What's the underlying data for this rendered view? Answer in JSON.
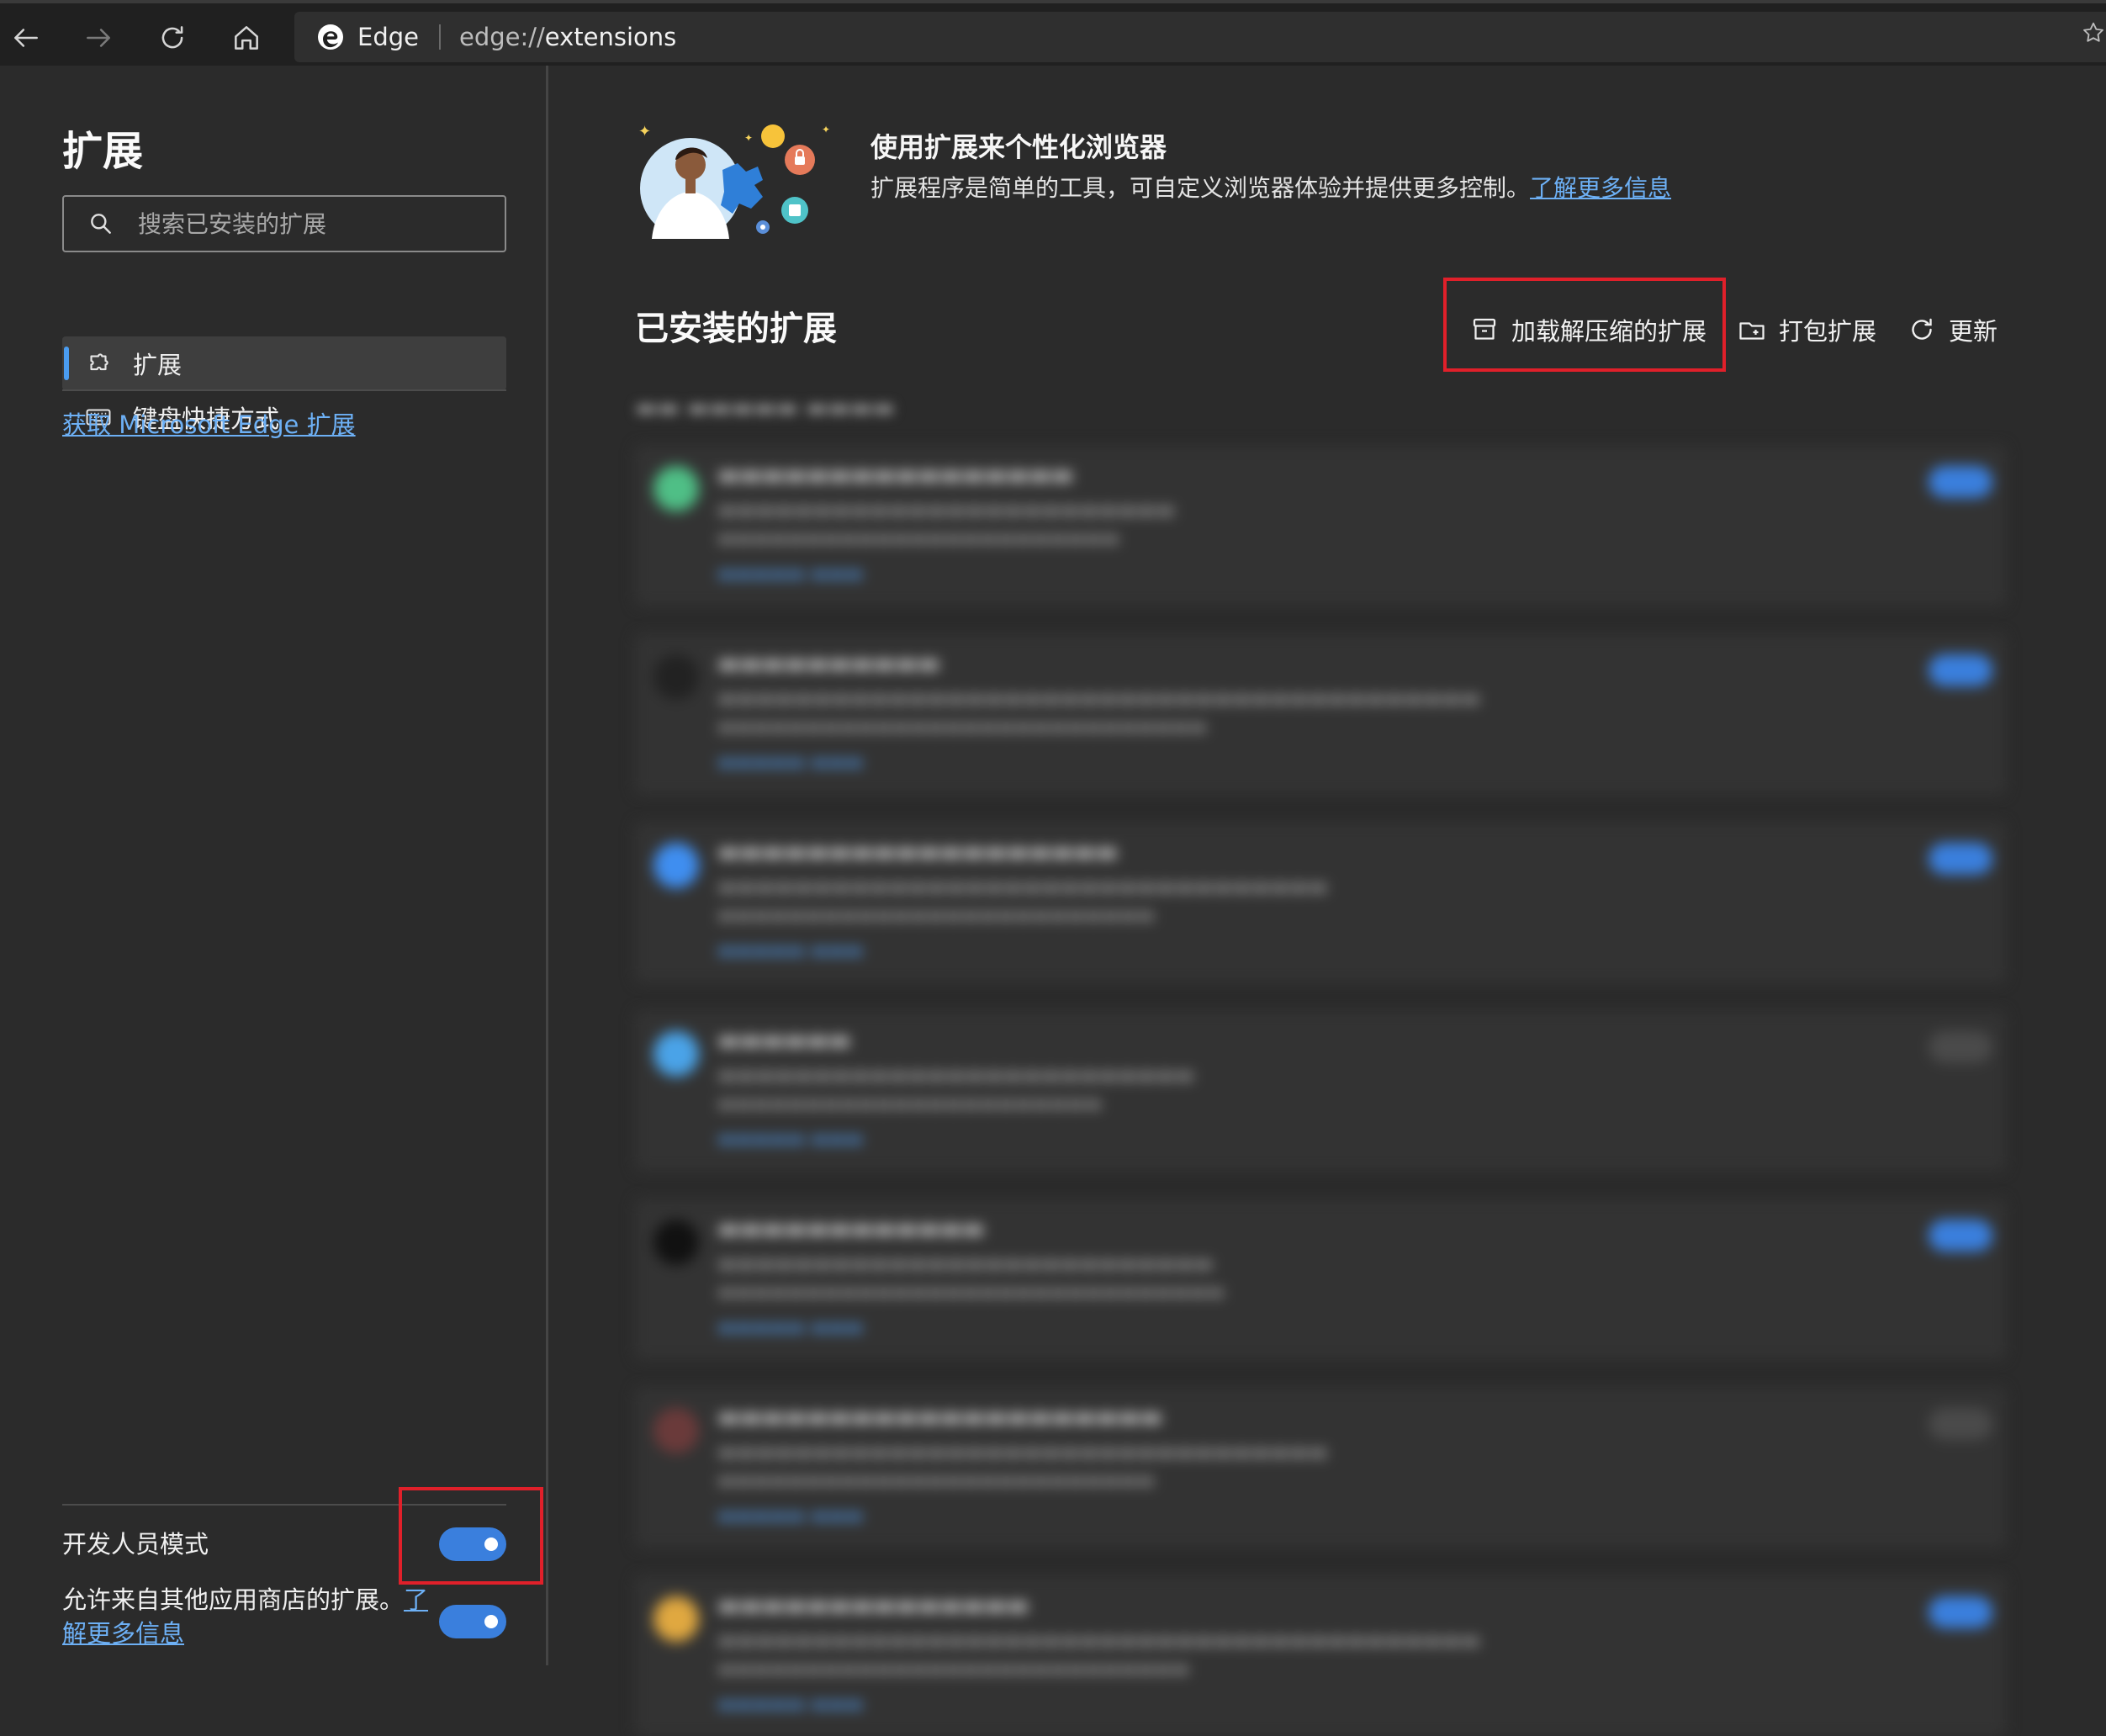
{
  "browser": {
    "brand": "Edge",
    "url_prefix": "edge://",
    "url_page": "extensions"
  },
  "sidebar": {
    "title": "扩展",
    "search_placeholder": "搜索已安装的扩展",
    "nav": [
      {
        "label": "扩展",
        "icon": "puzzle-icon",
        "active": true
      },
      {
        "label": "键盘快捷方式",
        "icon": "keyboard-icon",
        "active": false
      }
    ],
    "store_link": "获取 Microsoft Edge 扩展",
    "developer_mode_label": "开发人员模式",
    "developer_mode_on": true,
    "allow_other_stores_text": "允许来自其他应用商店的扩展。",
    "allow_other_stores_link": "了解更多信息",
    "allow_other_stores_on": true
  },
  "hero": {
    "title": "使用扩展来个性化浏览器",
    "description": "扩展程序是简单的工具，可自定义浏览器体验并提供更多控制。",
    "learn_more": "了解更多信息"
  },
  "installed": {
    "title": "已安装的扩展",
    "actions": {
      "load_unpacked": "加载解压缩的扩展",
      "pack": "打包扩展",
      "update": "更新"
    }
  },
  "colors": {
    "accent": "#3a7fdd",
    "link": "#6db0f5",
    "highlight_box": "#e0202a"
  }
}
